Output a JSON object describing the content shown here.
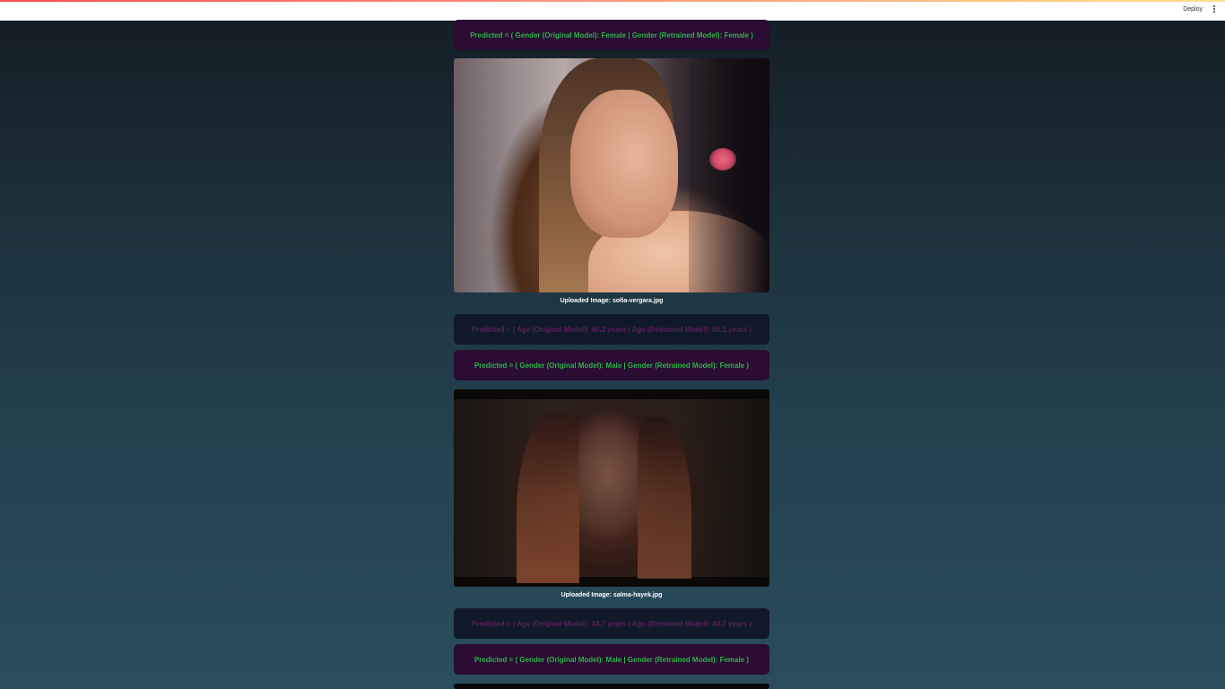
{
  "header": {
    "deploy_label": "Deploy",
    "menu_icon": "vertical-ellipsis-icon"
  },
  "results": [
    {
      "gender_prediction": "Predicted = ( Gender (Original Model): Female | Gender (Retrained Model): Female )"
    },
    {
      "caption": "Uploaded Image: sofia-vergara.jpg",
      "age_prediction": "Predicted = ( Age (Original Model): 46.3 years | Age (Retrained Model): 50.1 years )",
      "gender_prediction": "Predicted = ( Gender (Original Model): Male | Gender (Retrained Model): Female )"
    },
    {
      "caption": "Uploaded Image: salma-hayek.jpg",
      "age_prediction": "Predicted = ( Age (Original Model): 34.7 years | Age (Retrained Model): 44.7 years )",
      "gender_prediction": "Predicted = ( Gender (Original Model): Male | Gender (Retrained Model): Female )"
    }
  ],
  "colors": {
    "age_text": "#5d1f58",
    "gender_text": "#2bb44a",
    "age_box": "#10192a",
    "gender_box": "#2b0c32"
  }
}
